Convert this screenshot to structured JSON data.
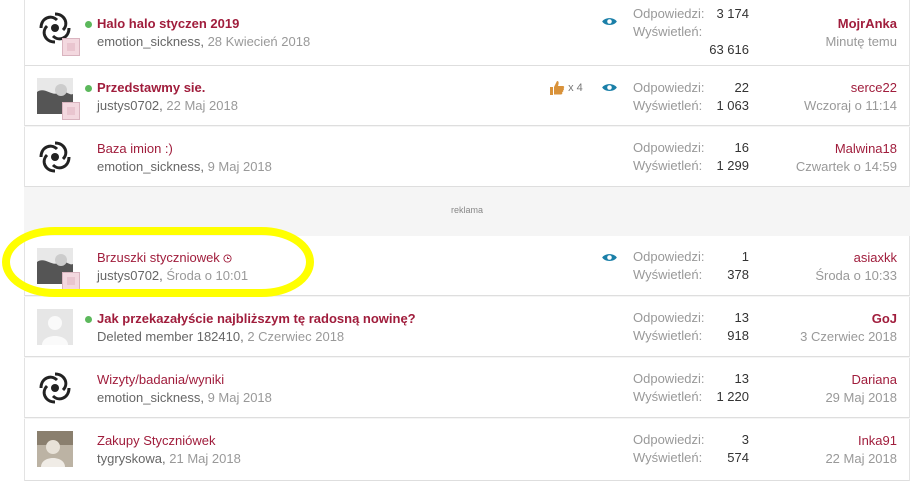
{
  "ad_label": "reklama",
  "stats_labels": {
    "replies": "Odpowiedzi:",
    "views": "Wyświetleń:"
  },
  "threads": [
    {
      "title": "Halo halo styczen 2019",
      "author": "emotion_sickness",
      "date": "28 Kwiecień 2018",
      "replies": "3 174",
      "views": "63 616",
      "last_user": "MojrAnka",
      "last_time": "Minutę temu"
    },
    {
      "title": "Przedstawmy sie.",
      "author": "justys0702",
      "date": "22 Maj 2018",
      "likes": "x 4",
      "replies": "22",
      "views": "1 063",
      "last_user": "serce22",
      "last_time": "Wczoraj o 11:14"
    },
    {
      "title": "Baza imion :)",
      "author": "emotion_sickness",
      "date": "9 Maj 2018",
      "replies": "16",
      "views": "1 299",
      "last_user": "Malwina18",
      "last_time": "Czwartek o 14:59"
    },
    {
      "title": "Brzuszki styczniowek",
      "author": "justys0702",
      "date": "Środa o 10:01",
      "replies": "1",
      "views": "378",
      "last_user": "asiaxkk",
      "last_time": "Środa o 10:33"
    },
    {
      "title": "Jak przekazałyście najbliższym tę radosną nowinę?",
      "author": "Deleted member 182410",
      "date": "2 Czerwiec 2018",
      "replies": "13",
      "views": "918",
      "last_user": "GoJ",
      "last_time": "3 Czerwiec 2018"
    },
    {
      "title": "Wizyty/badania/wyniki",
      "author": "emotion_sickness",
      "date": "9 Maj 2018",
      "replies": "13",
      "views": "1 220",
      "last_user": "Dariana",
      "last_time": "29 Maj 2018"
    },
    {
      "title": "Zakupy Styczniówek",
      "author": "tygryskowa",
      "date": "21 Maj 2018",
      "replies": "3",
      "views": "574",
      "last_user": "Inka91",
      "last_time": "22 Maj 2018"
    }
  ],
  "colors": {
    "link": "#a01d3c",
    "online": "#5cb85c",
    "eye": "#1a7fa8",
    "highlight": "#ffff00"
  },
  "icons": [
    "eye-icon",
    "thumbs-up-icon",
    "online-dot",
    "spiral-logo-avatar",
    "default-user-avatar",
    "photo-avatar"
  ]
}
